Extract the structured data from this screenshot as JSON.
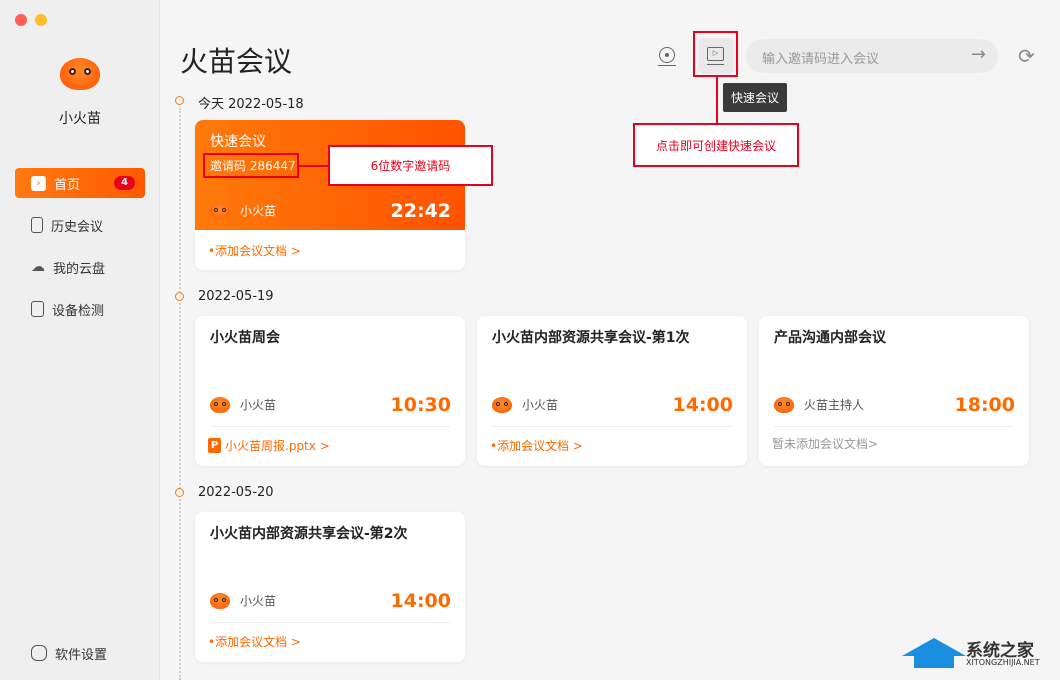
{
  "sidebar": {
    "username": "小火苗",
    "items": [
      {
        "label": "首页",
        "badge": "4"
      },
      {
        "label": "历史会议"
      },
      {
        "label": "我的云盘"
      },
      {
        "label": "设备检测"
      }
    ],
    "settings": "软件设置"
  },
  "header": {
    "title": "火苗会议",
    "invite_placeholder": "输入邀请码进入会议",
    "tooltip": "快速会议"
  },
  "groups": [
    {
      "date": "今天 2022-05-18",
      "cards": [
        {
          "title": "快速会议",
          "invite": "邀请码 286447",
          "host": "小火苗",
          "time": "22:42",
          "doc": "•添加会议文档 >"
        }
      ]
    },
    {
      "date": "2022-05-19",
      "cards": [
        {
          "title": "小火苗周会",
          "host": "小火苗",
          "time": "10:30",
          "doc": "小火苗周报.pptx >"
        },
        {
          "title": "小火苗内部资源共享会议-第1次",
          "host": "小火苗",
          "time": "14:00",
          "doc": "•添加会议文档 >"
        },
        {
          "title": "产品沟通内部会议",
          "host": "火苗主持人",
          "time": "18:00",
          "doc": "暂未添加会议文档>"
        }
      ]
    },
    {
      "date": "2022-05-20",
      "cards": [
        {
          "title": "小火苗内部资源共享会议-第2次",
          "host": "小火苗",
          "time": "14:00",
          "doc": "•添加会议文档 >"
        }
      ]
    }
  ],
  "annotations": {
    "invite_note": "6位数字邀请码",
    "quick_note": "点击即可创建快速会议"
  },
  "watermark": {
    "name": "系统之家",
    "url": "XITONGZHIJIA.NET"
  },
  "colors": {
    "accent": "#ff6a00",
    "annotation": "#e8001c"
  }
}
